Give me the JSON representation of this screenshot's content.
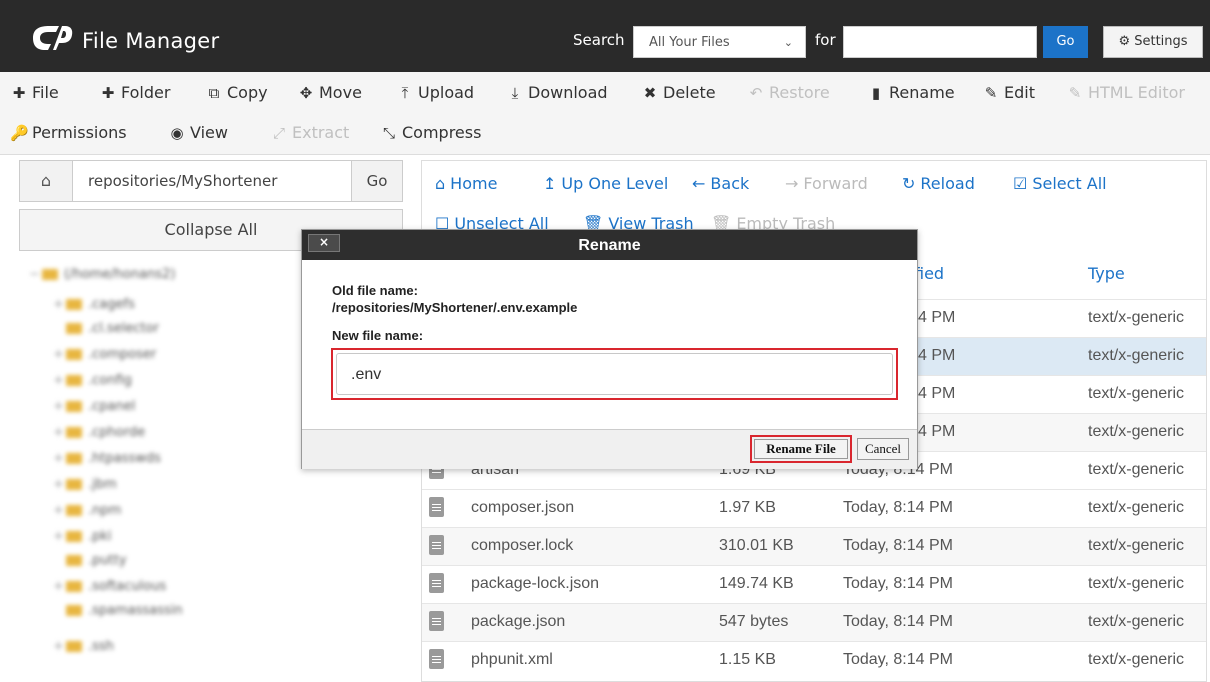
{
  "header": {
    "title": "File Manager",
    "search_label": "Search",
    "search_scope": "All Your Files",
    "for_label": "for",
    "search_value": "",
    "go_label": "Go",
    "settings_label": "Settings"
  },
  "toolbar": {
    "file": "File",
    "folder": "Folder",
    "copy": "Copy",
    "move": "Move",
    "upload": "Upload",
    "download": "Download",
    "delete": "Delete",
    "restore": "Restore",
    "rename": "Rename",
    "edit": "Edit",
    "html_editor": "HTML Editor",
    "permissions": "Permissions",
    "view": "View",
    "extract": "Extract",
    "compress": "Compress"
  },
  "left": {
    "path": "repositories/MyShortener",
    "go_label": "Go",
    "collapse_label": "Collapse All",
    "tree": [
      "(/home/honans2)",
      ".cagefs",
      ".cl.selector",
      ".composer",
      ".config",
      ".cpanel",
      ".cphorde",
      ".htpasswds",
      ".jbm",
      ".npm",
      ".pki",
      ".putty",
      ".softaculous",
      ".spamassassin",
      ".ssh"
    ]
  },
  "nav": {
    "home": "Home",
    "up": "Up One Level",
    "back": "Back",
    "forward": "Forward",
    "reload": "Reload",
    "select_all": "Select All",
    "unselect_all": "Unselect All",
    "view_trash": "View Trash",
    "empty_trash": "Empty Trash"
  },
  "table": {
    "col_modified_fragment": "fied",
    "col_type": "Type",
    "rows": [
      {
        "name": "",
        "size": "",
        "modified": "4 PM",
        "type": "text/x-generic"
      },
      {
        "name": "",
        "size": "",
        "modified": "4 PM",
        "type": "text/x-generic"
      },
      {
        "name": "",
        "size": "",
        "modified": "4 PM",
        "type": "text/x-generic"
      },
      {
        "name": "",
        "size": "",
        "modified": "4 PM",
        "type": "text/x-generic"
      },
      {
        "name": "artisan",
        "size": "1.69 KB",
        "modified": "Today, 8:14 PM",
        "type": "text/x-generic"
      },
      {
        "name": "composer.json",
        "size": "1.97 KB",
        "modified": "Today, 8:14 PM",
        "type": "text/x-generic"
      },
      {
        "name": "composer.lock",
        "size": "310.01 KB",
        "modified": "Today, 8:14 PM",
        "type": "text/x-generic"
      },
      {
        "name": "package-lock.json",
        "size": "149.74 KB",
        "modified": "Today, 8:14 PM",
        "type": "text/x-generic"
      },
      {
        "name": "package.json",
        "size": "547 bytes",
        "modified": "Today, 8:14 PM",
        "type": "text/x-generic"
      },
      {
        "name": "phpunit.xml",
        "size": "1.15 KB",
        "modified": "Today, 8:14 PM",
        "type": "text/x-generic"
      }
    ]
  },
  "modal": {
    "close": "×",
    "title": "Rename",
    "old_label": "Old file name:",
    "old_value": "/repositories/MyShortener/.env.example",
    "new_label": "New file name:",
    "new_value": ".env",
    "rename_button": "Rename File",
    "cancel_button": "Cancel"
  },
  "colors": {
    "accent": "#1c73c8",
    "header": "#2a2a2a",
    "highlight": "#d9262e",
    "folder": "#e8b640"
  }
}
